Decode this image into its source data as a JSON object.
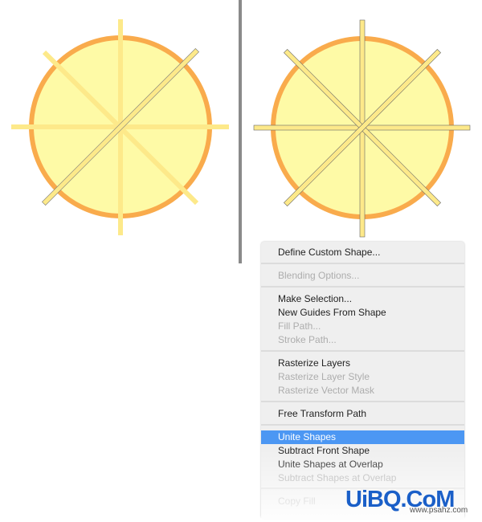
{
  "colors": {
    "circle_fill": "#fefaa6",
    "circle_stroke": "#f9ab4c",
    "ray": "#fde98a",
    "highlight": "#4c97f3"
  },
  "menu": {
    "items": [
      {
        "label": "Define Custom Shape...",
        "enabled": true
      },
      {
        "label": "Blending Options...",
        "enabled": false
      },
      {
        "label": "Make Selection...",
        "enabled": true
      },
      {
        "label": "New Guides From Shape",
        "enabled": true
      },
      {
        "label": "Fill Path...",
        "enabled": false
      },
      {
        "label": "Stroke Path...",
        "enabled": false
      },
      {
        "label": "Rasterize Layers",
        "enabled": true
      },
      {
        "label": "Rasterize Layer Style",
        "enabled": false
      },
      {
        "label": "Rasterize Vector Mask",
        "enabled": false
      },
      {
        "label": "Free Transform Path",
        "enabled": true
      },
      {
        "label": "Unite Shapes",
        "enabled": true,
        "selected": true
      },
      {
        "label": "Subtract Front Shape",
        "enabled": true
      },
      {
        "label": "Unite Shapes at Overlap",
        "enabled": true
      },
      {
        "label": "Subtract Shapes at Overlap",
        "enabled": false
      },
      {
        "label": "Copy Fill",
        "enabled": false
      }
    ]
  },
  "watermark": {
    "logo": "UiBQ.CoM",
    "url": "www.psahz.com"
  }
}
